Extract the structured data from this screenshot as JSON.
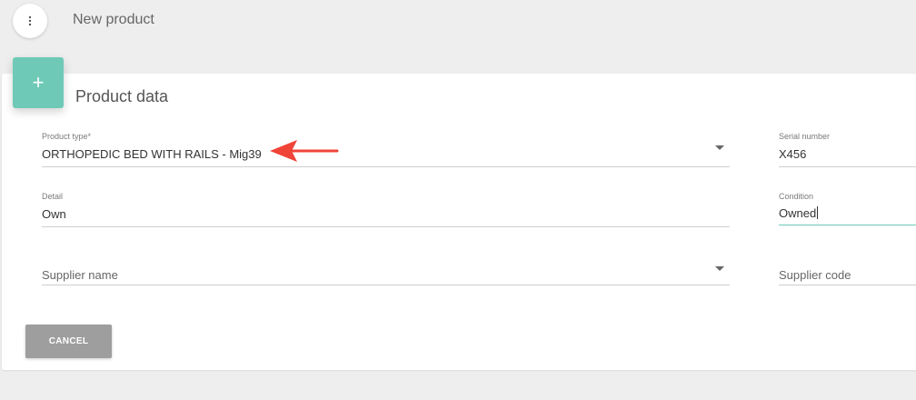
{
  "header": {
    "title": "New product",
    "menu_icon": "more-vertical-icon"
  },
  "card": {
    "icon": "plus-icon",
    "icon_glyph": "+",
    "icon_color": "#6ecab7",
    "title": "Product data"
  },
  "form": {
    "product_type": {
      "label": "Product type*",
      "value": "ORTHOPEDIC BED WITH RAILS - Mig39"
    },
    "serial_number": {
      "label": "Serial number",
      "value": "X456"
    },
    "detail": {
      "label": "Detail",
      "value": "Own"
    },
    "condition": {
      "label": "Condition",
      "value": "Owned"
    },
    "supplier_name": {
      "placeholder": "Supplier name"
    },
    "supplier_code": {
      "placeholder": "Supplier code"
    }
  },
  "annotation": {
    "arrow_color": "#f04438"
  },
  "actions": {
    "cancel_label": "CANCEL"
  }
}
